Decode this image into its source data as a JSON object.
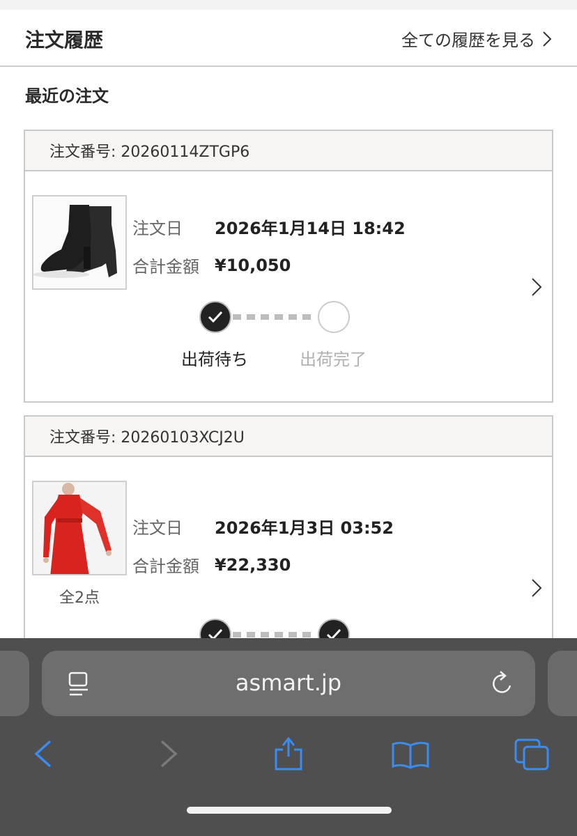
{
  "header": {
    "title": "注文履歴",
    "view_all": "全ての履歴を見る"
  },
  "section_title": "最近の注文",
  "orders": [
    {
      "order_number": "注文番号: 20260114ZTGP6",
      "date_label": "注文日",
      "date_value": "2026年1月14日 18:42",
      "total_label": "合計金額",
      "total_value": "¥10,050",
      "steps": [
        "出荷待ち",
        "出荷完了"
      ]
    },
    {
      "order_number": "注文番号: 20260103XCJ2U",
      "date_label": "注文日",
      "date_value": "2026年1月3日 03:52",
      "total_label": "合計金額",
      "total_value": "¥22,330",
      "item_count": "全2点"
    }
  ],
  "browser": {
    "url": "asmart.jp",
    "icons": [
      "reader-icon",
      "reload-icon",
      "back-icon",
      "forward-icon",
      "share-icon",
      "bookmarks-icon",
      "tabs-icon"
    ],
    "accent_color": "#3b8cf0"
  }
}
